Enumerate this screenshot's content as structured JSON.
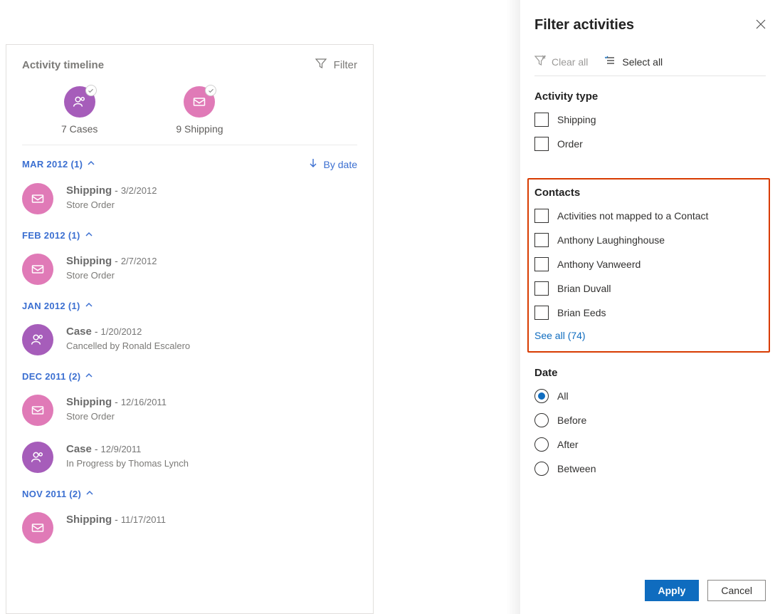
{
  "timeline": {
    "title": "Activity timeline",
    "filter_label": "Filter",
    "summary": {
      "cases": "7 Cases",
      "shipping": "9 Shipping"
    },
    "bydate": "By date",
    "groups": [
      {
        "header": "MAR 2012 (1)",
        "items": [
          {
            "type": "Shipping",
            "kind": "shipping",
            "date": "3/2/2012",
            "sub": "Store Order"
          }
        ]
      },
      {
        "header": "FEB 2012 (1)",
        "items": [
          {
            "type": "Shipping",
            "kind": "shipping",
            "date": "2/7/2012",
            "sub": "Store Order"
          }
        ]
      },
      {
        "header": "JAN 2012 (1)",
        "items": [
          {
            "type": "Case",
            "kind": "case",
            "date": "1/20/2012",
            "sub": "Cancelled by Ronald Escalero"
          }
        ]
      },
      {
        "header": "DEC 2011 (2)",
        "items": [
          {
            "type": "Shipping",
            "kind": "shipping",
            "date": "12/16/2011",
            "sub": "Store Order"
          },
          {
            "type": "Case",
            "kind": "case",
            "date": "12/9/2011",
            "sub": "In Progress by Thomas Lynch"
          }
        ]
      },
      {
        "header": "NOV 2011 (2)",
        "items": [
          {
            "type": "Shipping",
            "kind": "shipping",
            "date": "11/17/2011",
            "sub": ""
          }
        ]
      }
    ]
  },
  "panel": {
    "title": "Filter activities",
    "clear_all": "Clear all",
    "select_all": "Select all",
    "activity_type_head": "Activity type",
    "activity_types": [
      "Shipping",
      "Order"
    ],
    "contacts_head": "Contacts",
    "contacts": [
      "Activities not mapped to a Contact",
      "Anthony Laughinghouse",
      "Anthony Vanweerd",
      "Brian Duvall",
      "Brian Eeds"
    ],
    "see_all": "See all (74)",
    "date_head": "Date",
    "date_options": [
      "All",
      "Before",
      "After",
      "Between"
    ],
    "date_selected": "All",
    "apply": "Apply",
    "cancel": "Cancel"
  }
}
